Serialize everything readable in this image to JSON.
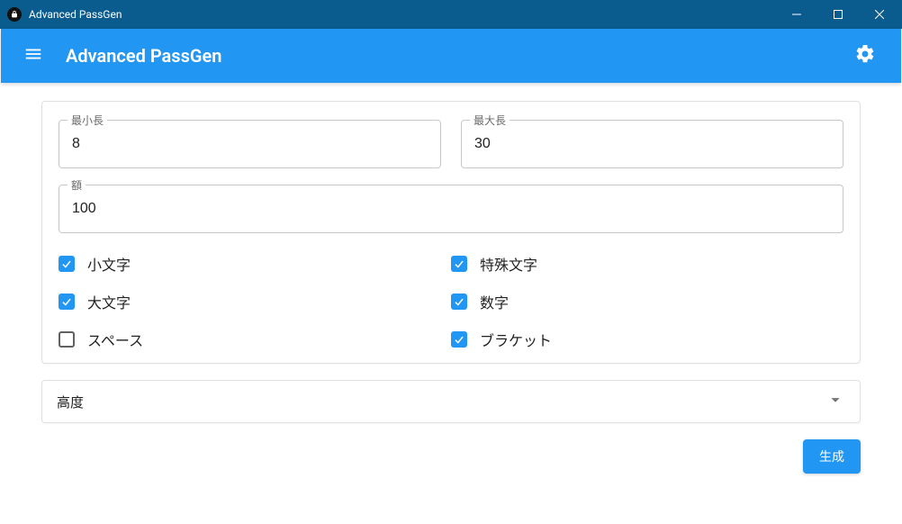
{
  "window": {
    "title": "Advanced PassGen"
  },
  "header": {
    "title": "Advanced PassGen"
  },
  "form": {
    "min_length": {
      "label": "最小長",
      "value": "8"
    },
    "max_length": {
      "label": "最大長",
      "value": "30"
    },
    "amount": {
      "label": "額",
      "value": "100"
    },
    "checks": {
      "lowercase": {
        "label": "小文字",
        "checked": true
      },
      "uppercase": {
        "label": "大文字",
        "checked": true
      },
      "spaces": {
        "label": "スペース",
        "checked": false
      },
      "special": {
        "label": "特殊文字",
        "checked": true
      },
      "numbers": {
        "label": "数字",
        "checked": true
      },
      "brackets": {
        "label": "ブラケット",
        "checked": true
      }
    }
  },
  "accordion": {
    "advanced_label": "高度"
  },
  "actions": {
    "generate_label": "生成"
  }
}
